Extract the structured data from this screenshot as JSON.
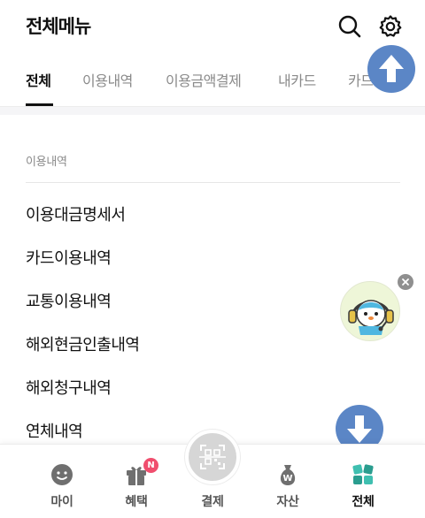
{
  "header": {
    "title": "전체메뉴",
    "search_icon": "search-icon",
    "settings_icon": "gear-icon"
  },
  "tabs": [
    {
      "label": "전체",
      "active": true
    },
    {
      "label": "이용내역",
      "active": false
    },
    {
      "label": "이용금액결제",
      "active": false
    },
    {
      "label": "내카드",
      "active": false
    },
    {
      "label": "카드",
      "active": false
    }
  ],
  "section": {
    "title": "이용내역",
    "items": [
      {
        "label": "이용대금명세서"
      },
      {
        "label": "카드이용내역"
      },
      {
        "label": "교통이용내역"
      },
      {
        "label": "해외현금인출내역"
      },
      {
        "label": "해외청구내역"
      },
      {
        "label": "연체내역"
      }
    ]
  },
  "floating": {
    "scroll_up_icon": "arrow-up-icon",
    "scroll_down_icon": "arrow-down-icon",
    "mascot": "mascot-chatbot-icon"
  },
  "bottom_nav": {
    "items": [
      {
        "label": "마이",
        "icon": "smile-face-icon",
        "active": false
      },
      {
        "label": "혜택",
        "icon": "gift-icon",
        "active": false,
        "badge": "N"
      },
      {
        "label": "결제",
        "icon": "qr-code-icon",
        "active": false
      },
      {
        "label": "자산",
        "icon": "money-bag-icon",
        "active": false
      },
      {
        "label": "전체",
        "icon": "all-menu-icon",
        "active": true
      }
    ]
  },
  "colors": {
    "accent_blue": "#5b86c6",
    "badge_pink": "#f04e6e",
    "active_text": "#111111",
    "inactive_text": "#8a8a8a",
    "teal": "#3fbfb0"
  }
}
